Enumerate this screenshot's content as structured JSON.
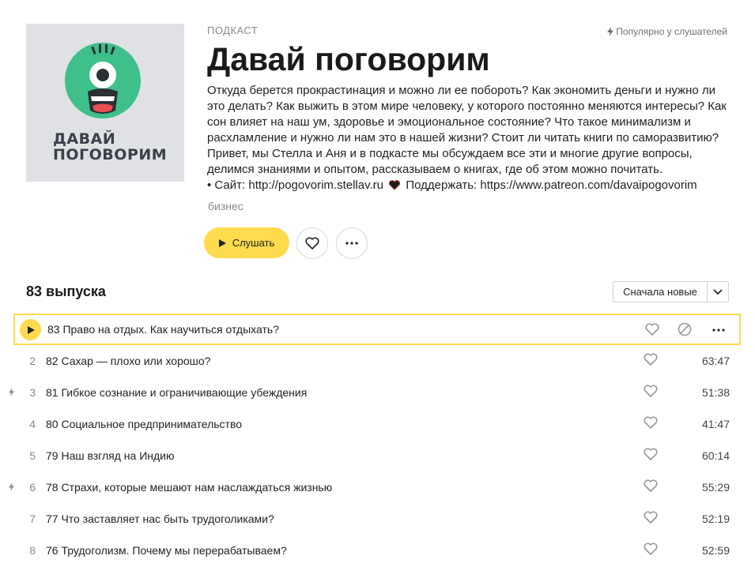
{
  "podcast": {
    "kind": "ПОДКАСТ",
    "title": "Давай поговорим",
    "popular_label": "Популярно у слушателей",
    "cover_title_line1": "ДАВАЙ",
    "cover_title_line2": "ПОГОВОРИМ",
    "description_lines": [
      "Откуда берется прокрастинация и можно ли ее побороть? Как экономить деньги и нужно ли",
      "это делать? Как выжить в этом мире человеку, у которого постоянно меняются интересы? Как",
      "сон влияет на наш ум, здоровье и эмоциональное состояние? Что такое минимализм и",
      "расхламление и нужно ли нам это в нашей жизни? Стоит ли читать книги по саморазвитию?",
      "Привет, мы Стелла и Аня и в подкасте мы обсуждаем все эти и многие другие вопросы,",
      "делимся знаниями и опытом, рассказываем о книгах, где об этом можно почитать."
    ],
    "site_line_prefix": "• Сайт: http://pogovorim.stellav.ru",
    "site_line_suffix": "Поддержать: https://www.patreon.com/davaipogovorim",
    "genre": "бизнес"
  },
  "actions": {
    "listen_label": "Слушать",
    "like_icon": "heart-icon",
    "more_icon": "more-dots-icon"
  },
  "episodes_header": {
    "count_label": "83 выпуска",
    "sort_label": "Сначала новые"
  },
  "episodes": [
    {
      "num": "",
      "title": "83 Право на отдых. Как научиться отдыхать?",
      "duration": "",
      "active": true,
      "popular": false
    },
    {
      "num": "2",
      "title": "82 Сахар — плохо или хорошо?",
      "duration": "63:47",
      "active": false,
      "popular": false
    },
    {
      "num": "3",
      "title": "81 Гибкое сознание и ограничивающие убеждения",
      "duration": "51:38",
      "active": false,
      "popular": true
    },
    {
      "num": "4",
      "title": "80 Социальное предпринимательство",
      "duration": "41:47",
      "active": false,
      "popular": false
    },
    {
      "num": "5",
      "title": "79 Наш взгляд на Индию",
      "duration": "60:14",
      "active": false,
      "popular": false
    },
    {
      "num": "6",
      "title": "78 Страхи, которые мешают нам наслаждаться жизнью",
      "duration": "55:29",
      "active": false,
      "popular": true
    },
    {
      "num": "7",
      "title": "77 Что заставляет нас быть трудоголиками?",
      "duration": "52:19",
      "active": false,
      "popular": false
    },
    {
      "num": "8",
      "title": "76 Трудоголизм. Почему мы перерабатываем?",
      "duration": "52:59",
      "active": false,
      "popular": false
    }
  ],
  "colors": {
    "accent": "#ffdb4d",
    "cover_bg": "#dfe1e5",
    "monster_green": "#3fbf8a"
  }
}
